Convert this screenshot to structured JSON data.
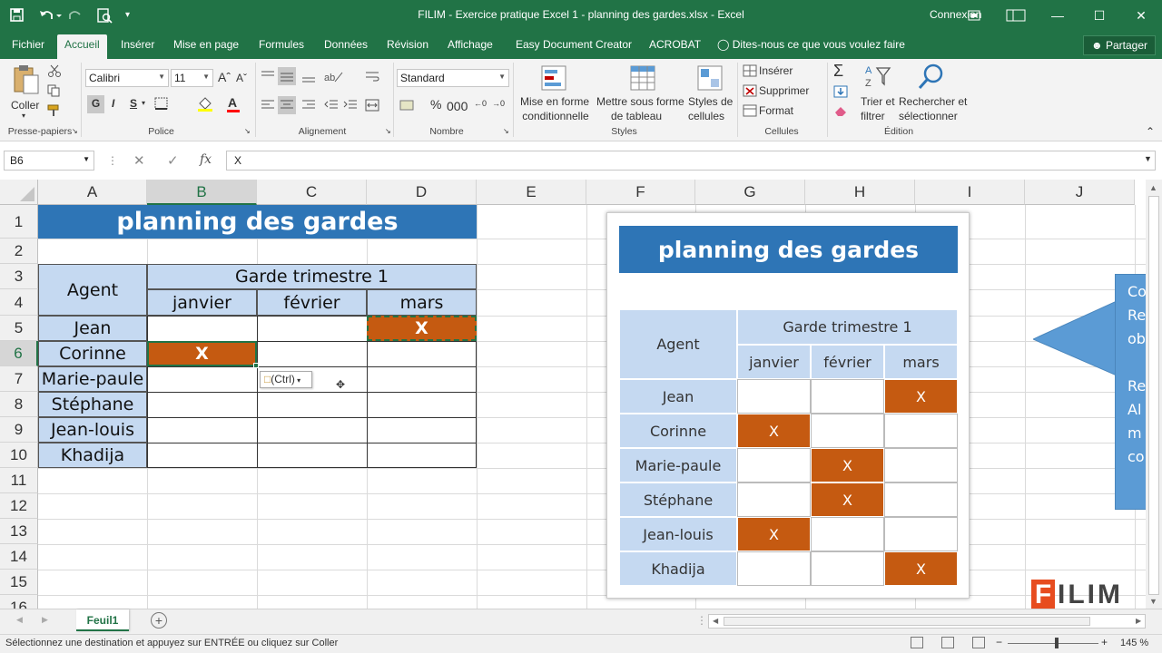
{
  "window": {
    "title": "FILIM - Exercice pratique Excel 1 - planning des gardes.xlsx  -  Excel",
    "signin": "Connexion"
  },
  "tabs": [
    "Fichier",
    "Accueil",
    "Insérer",
    "Mise en page",
    "Formules",
    "Données",
    "Révision",
    "Affichage",
    "Easy Document Creator",
    "ACROBAT"
  ],
  "tell_me": "Dites-nous ce que vous voulez faire",
  "share": "Partager",
  "ribbon": {
    "paste": "Coller",
    "font_name": "Calibri",
    "font_size": "11",
    "bold": "G",
    "italic": "I",
    "underline": "S",
    "number_format": "Standard",
    "cond_format": [
      "Mise en forme",
      "conditionnelle"
    ],
    "table_format": [
      "Mettre sous forme",
      "de tableau"
    ],
    "cell_styles": [
      "Styles de",
      "cellules"
    ],
    "insert": "Insérer",
    "delete": "Supprimer",
    "format": "Format",
    "sort": [
      "Trier et",
      "filtrer"
    ],
    "find": [
      "Rechercher et",
      "sélectionner"
    ],
    "groups": [
      "Presse-papiers",
      "Police",
      "Alignement",
      "Nombre",
      "Styles",
      "Cellules",
      "Édition"
    ]
  },
  "formula_bar": {
    "name_box": "B6",
    "fx": "fx",
    "value": "X"
  },
  "columns": [
    "A",
    "B",
    "C",
    "D",
    "E",
    "F",
    "G",
    "H",
    "I",
    "J"
  ],
  "rows": [
    "1",
    "2",
    "3",
    "4",
    "5",
    "6",
    "7",
    "8",
    "9",
    "10",
    "11",
    "12",
    "13",
    "14",
    "15",
    "16"
  ],
  "sheet": {
    "title": "planning des gardes",
    "agent_header": "Agent",
    "quarter_header": "Garde trimestre 1",
    "months": [
      "janvier",
      "février",
      "mars"
    ],
    "agents": [
      "Jean",
      "Corinne",
      "Marie-paule",
      "Stéphane",
      "Jean-louis",
      "Khadija"
    ],
    "marks": {
      "jean_mars": "X",
      "corinne_janvier": "X"
    }
  },
  "paste_options": "(Ctrl)",
  "embedded_image": {
    "title": "planning des gardes",
    "agent_header": "Agent",
    "quarter_header": "Garde trimestre 1",
    "months": [
      "janvier",
      "février",
      "mars"
    ],
    "rows": [
      {
        "name": "Jean",
        "marks": [
          "",
          "",
          "X"
        ]
      },
      {
        "name": "Corinne",
        "marks": [
          "X",
          "",
          ""
        ]
      },
      {
        "name": "Marie-paule",
        "marks": [
          "",
          "X",
          ""
        ]
      },
      {
        "name": "Stéphane",
        "marks": [
          "",
          "X",
          ""
        ]
      },
      {
        "name": "Jean-louis",
        "marks": [
          "X",
          "",
          ""
        ]
      },
      {
        "name": "Khadija",
        "marks": [
          "",
          "",
          "X"
        ]
      }
    ]
  },
  "callout_text": [
    "Co",
    "Re",
    "ob",
    "",
    "Re",
    "Al",
    "m",
    "co"
  ],
  "sheet_tab": "Feuil1",
  "status": {
    "message": "Sélectionnez une destination et appuyez sur ENTRÉE ou cliquez sur Coller",
    "zoom": "145 %"
  },
  "logo": {
    "first": "F",
    "rest": "ILIM"
  },
  "colors": {
    "excel_green": "#217346",
    "header_blue": "#2e75b6",
    "cell_blue": "#c5d9f1",
    "mark_orange": "#c55a11"
  }
}
